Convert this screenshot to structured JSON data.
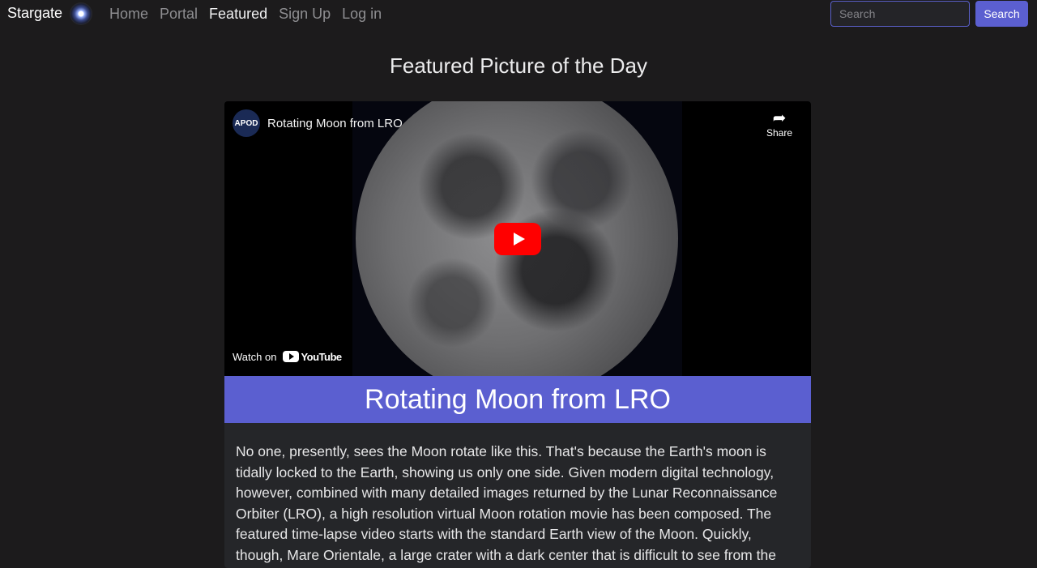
{
  "navbar": {
    "brand": "Stargate",
    "links": [
      "Home",
      "Portal",
      "Featured",
      "Sign Up",
      "Log in"
    ],
    "active_link": "Featured",
    "search_placeholder": "Search",
    "search_button": "Search"
  },
  "page_title": "Featured Picture of the Day",
  "video": {
    "channel_avatar_text": "APOD",
    "title": "Rotating Moon from LRO",
    "share_label": "Share",
    "watch_on_label": "Watch on",
    "youtube_label": "YouTube"
  },
  "banner_title": "Rotating Moon from LRO",
  "description": "No one, presently, sees the Moon rotate like this. That's because the Earth's moon is tidally locked to the Earth, showing us only one side. Given modern digital technology, however, combined with many detailed images returned by the Lunar Reconnaissance Orbiter (LRO), a high resolution virtual Moon rotation movie has been composed. The featured time-lapse video starts with the standard Earth view of the Moon. Quickly, though, Mare Orientale, a large crater with a dark center that is difficult to see from the Earth, rotates into view just below the",
  "colors": {
    "accent": "#5b5fd0",
    "background": "#1c1b1c",
    "youtube_red": "#ff0000"
  }
}
